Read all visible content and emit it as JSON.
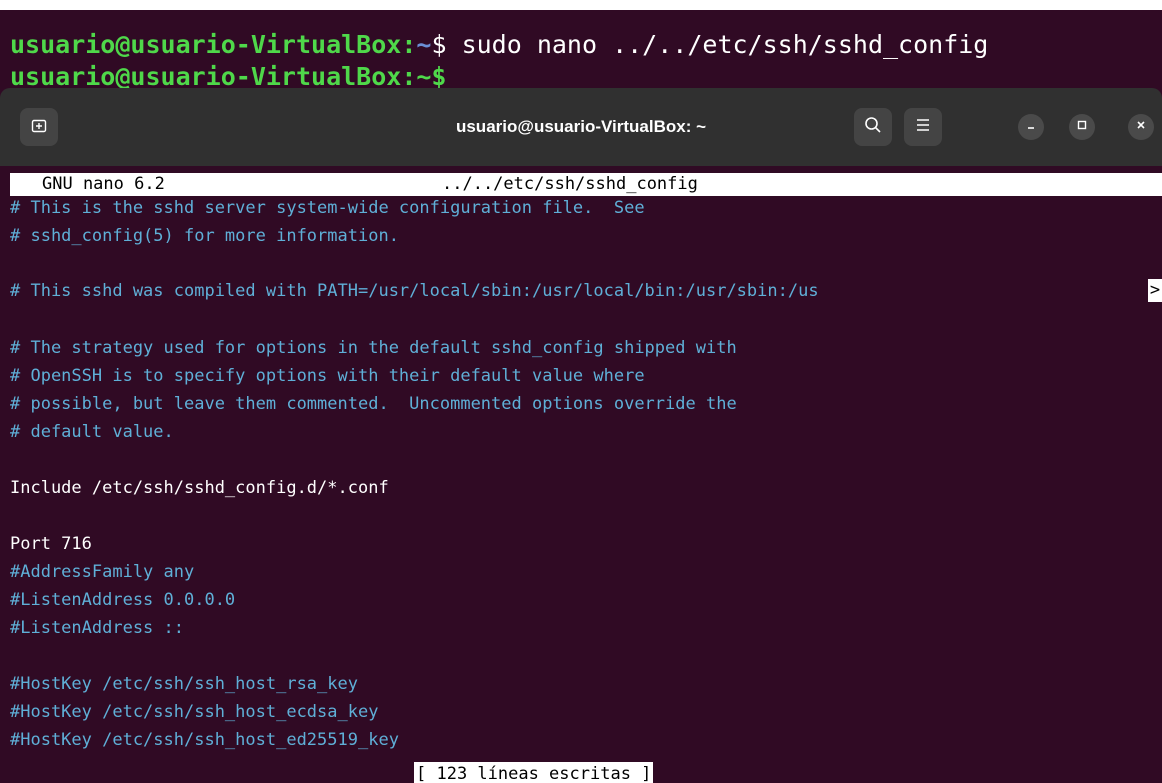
{
  "background_terminal": {
    "line1_user": "usuario@usuario-VirtualBox:",
    "line1_path": "~",
    "line1_prompt": "$",
    "line1_command": " sudo nano ../../etc/ssh/sshd_config",
    "line2_text": "usuario@usuario-VirtualBox:~$"
  },
  "window": {
    "title": "usuario@usuario-VirtualBox: ~",
    "new_tab_icon": "new-tab-icon",
    "search_icon": "search-icon",
    "menu_icon": "hamburger-menu-icon",
    "minimize_icon": "minimize-icon",
    "maximize_icon": "maximize-icon",
    "close_icon": "close-icon"
  },
  "nano": {
    "version": "GNU nano 6.2",
    "filename": "../../etc/ssh/sshd_config",
    "status_message": "[ 123 líneas escritas ]",
    "lines": [
      {
        "text": "# This is the sshd server system-wide configuration file.  See",
        "type": "comment"
      },
      {
        "text": "# sshd_config(5) for more information.",
        "type": "comment"
      },
      {
        "text": "",
        "type": "blank"
      },
      {
        "text": "# This sshd was compiled with PATH=/usr/local/sbin:/usr/local/bin:/usr/sbin:/us",
        "type": "comment"
      },
      {
        "text": "",
        "type": "blank"
      },
      {
        "text": "# The strategy used for options in the default sshd_config shipped with",
        "type": "comment"
      },
      {
        "text": "# OpenSSH is to specify options with their default value where",
        "type": "comment"
      },
      {
        "text": "# possible, but leave them commented.  Uncommented options override the",
        "type": "comment"
      },
      {
        "text": "# default value.",
        "type": "comment"
      },
      {
        "text": "",
        "type": "blank"
      },
      {
        "text": "Include /etc/ssh/sshd_config.d/*.conf",
        "type": "plain"
      },
      {
        "text": "",
        "type": "blank"
      },
      {
        "text": "Port 716",
        "type": "plain"
      },
      {
        "text": "#AddressFamily any",
        "type": "comment"
      },
      {
        "text": "#ListenAddress 0.0.0.0",
        "type": "comment"
      },
      {
        "text": "#ListenAddress ::",
        "type": "comment"
      },
      {
        "text": "",
        "type": "blank"
      },
      {
        "text": "#HostKey /etc/ssh/ssh_host_rsa_key",
        "type": "comment"
      },
      {
        "text": "#HostKey /etc/ssh/ssh_host_ecdsa_key",
        "type": "comment"
      },
      {
        "text": "#HostKey /etc/ssh/ssh_host_ed25519_key",
        "type": "comment"
      }
    ],
    "overflow_marker": ">"
  },
  "colors": {
    "terminal_bg": "#300a24",
    "titlebar_bg": "#303030",
    "comment": "#5fafd7",
    "prompt_user": "#4fd84a",
    "prompt_path": "#6b8fd6"
  }
}
